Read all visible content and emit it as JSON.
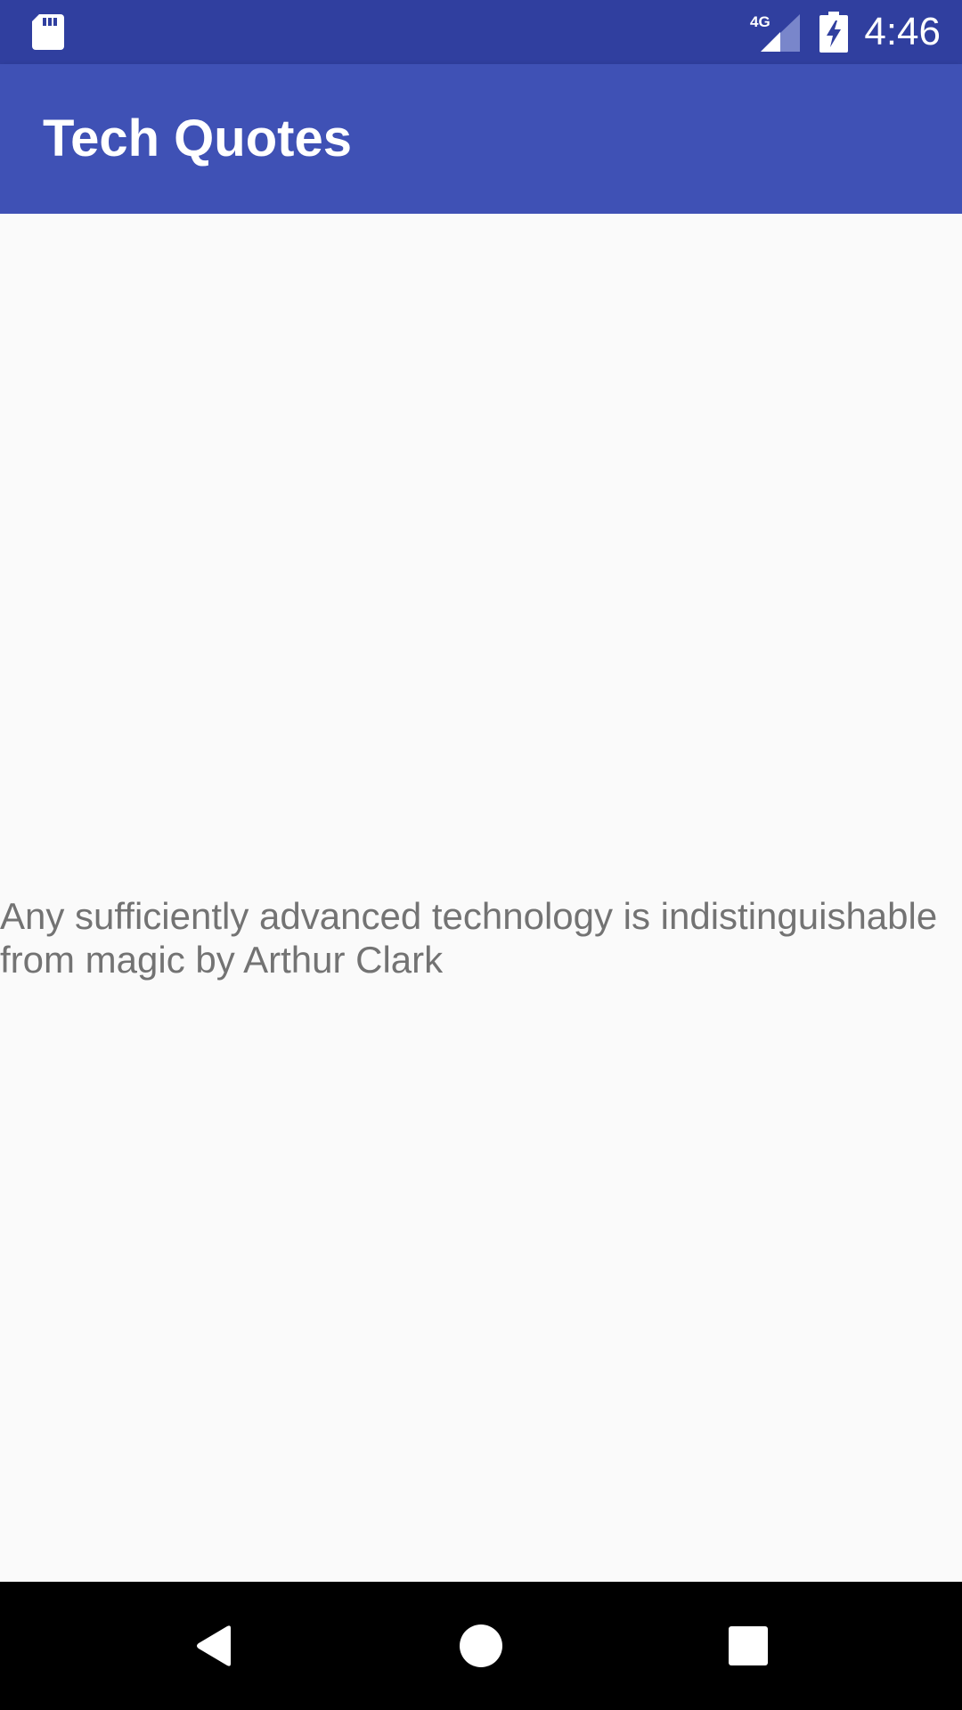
{
  "status_bar": {
    "time": "4:46",
    "network_label": "4G",
    "icons": [
      "sd-card-icon",
      "signal-4g-icon",
      "battery-charging-icon"
    ],
    "color": "#303f9f"
  },
  "app_bar": {
    "title": "Tech Quotes",
    "color": "#3f51b5"
  },
  "main": {
    "quote": "Any sufficiently advanced technology is indistinguishable from magic by Arthur Clark",
    "text_color": "#737373",
    "background": "#fafafa"
  },
  "nav_bar": {
    "buttons": [
      "back-icon",
      "home-icon",
      "recents-icon"
    ],
    "color": "#000000"
  }
}
